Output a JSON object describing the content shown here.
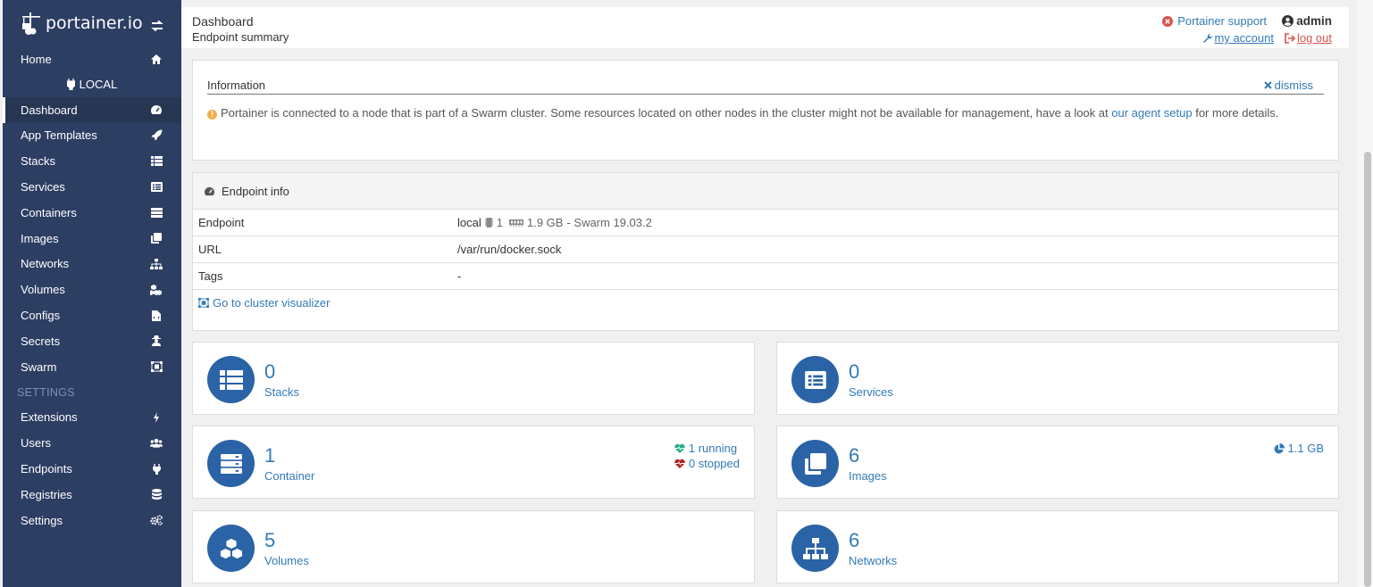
{
  "brand": {
    "logo_text": "portainer.io"
  },
  "sidebar": {
    "items_top": [
      {
        "label": "Home",
        "icon": "home-icon"
      }
    ],
    "endpoint_label": "LOCAL",
    "items": [
      {
        "label": "Dashboard",
        "icon": "tachometer-icon",
        "active": true
      },
      {
        "label": "App Templates",
        "icon": "rocket-icon"
      },
      {
        "label": "Stacks",
        "icon": "th-list-icon"
      },
      {
        "label": "Services",
        "icon": "list-alt-icon"
      },
      {
        "label": "Containers",
        "icon": "server-icon"
      },
      {
        "label": "Images",
        "icon": "clone-icon"
      },
      {
        "label": "Networks",
        "icon": "sitemap-icon"
      },
      {
        "label": "Volumes",
        "icon": "cubes-icon"
      },
      {
        "label": "Configs",
        "icon": "file-code-icon"
      },
      {
        "label": "Secrets",
        "icon": "user-secret-icon"
      },
      {
        "label": "Swarm",
        "icon": "object-group-icon"
      }
    ],
    "settings_label": "SETTINGS",
    "settings_items": [
      {
        "label": "Extensions",
        "icon": "bolt-icon"
      },
      {
        "label": "Users",
        "icon": "users-icon"
      },
      {
        "label": "Endpoints",
        "icon": "plug-icon"
      },
      {
        "label": "Registries",
        "icon": "database-icon"
      },
      {
        "label": "Settings",
        "icon": "cogs-icon"
      }
    ]
  },
  "header": {
    "title": "Dashboard",
    "subtitle": "Endpoint summary",
    "support_label": "Portainer support",
    "user": "admin",
    "account_label": " my account ",
    "logout_label": " log out"
  },
  "info": {
    "title": "Information",
    "dismiss_label": "dismiss",
    "message_before": "Portainer is connected to a node that is part of a Swarm cluster. Some resources located on other nodes in the cluster might not be available for management, have a look at ",
    "link_text": "our agent setup",
    "message_after": " for more details."
  },
  "endpoint_info": {
    "title": "Endpoint info",
    "rows": [
      {
        "key": "Endpoint",
        "value": "local",
        "cpu": "1",
        "memory": "1.9 GB",
        "swarm": "- Swarm 19.03.2"
      },
      {
        "key": "URL",
        "value": "/var/run/docker.sock"
      },
      {
        "key": "Tags",
        "value": "-"
      }
    ],
    "visualizer_link": "Go to cluster visualizer"
  },
  "tiles": {
    "stacks": {
      "count": "0",
      "label": "Stacks"
    },
    "services": {
      "count": "0",
      "label": "Services"
    },
    "containers": {
      "count": "1",
      "label": "Container",
      "running": "1 running",
      "stopped": "0 stopped"
    },
    "images": {
      "count": "6",
      "label": "Images",
      "size": "1.1 GB"
    },
    "volumes": {
      "count": "5",
      "label": "Volumes"
    },
    "networks": {
      "count": "6",
      "label": "Networks"
    }
  },
  "colors": {
    "sidebar": "#2d3e63",
    "accent": "#337ab7",
    "tile_circle": "#2a63a6",
    "running": "#23ae89",
    "stopped": "#ae2323"
  }
}
